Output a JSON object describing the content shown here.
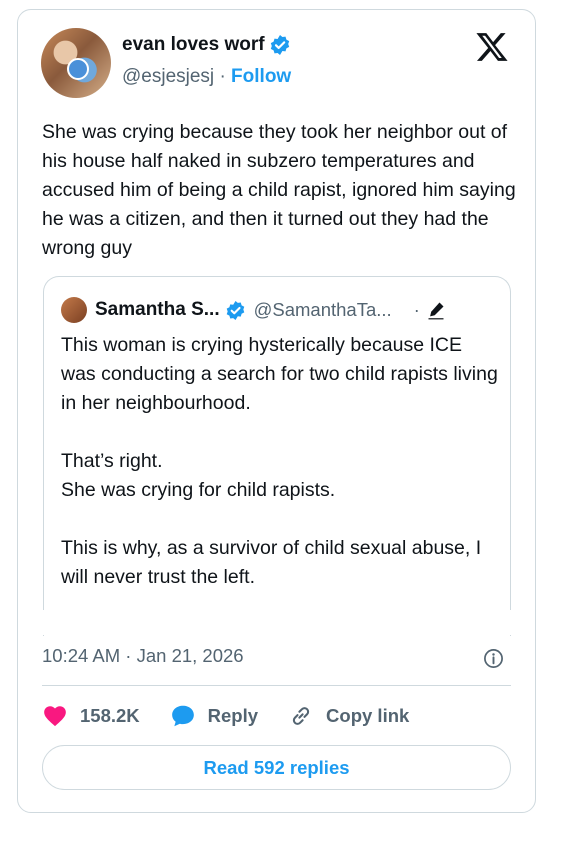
{
  "author": {
    "name": "evan loves worf",
    "handle": "@esjesjesj",
    "separator": "·",
    "follow_label": "Follow"
  },
  "tweet": {
    "text": "She was crying because they took her neighbor out of his house half naked in subzero temperatures and accused him of being a child rapist, ignored him saying he was a citizen, and then it turned out they had the wrong guy"
  },
  "quote": {
    "name": "Samantha S...",
    "handle": "@SamanthaTa...",
    "separator": "·",
    "paragraphs": [
      "This woman is crying hysterically because ICE was conducting a search for two child rapists living in her neighbourhood.",
      "That’s right.\nShe was crying for child rapists.",
      "This is why, as a survivor of child sexual abuse, I will never trust the left."
    ]
  },
  "meta": {
    "timestamp": "10:24 AM · Jan 21, 2026"
  },
  "actions": {
    "like_count": "158.2K",
    "reply_label": "Reply",
    "copy_label": "Copy link"
  },
  "footer": {
    "read_replies_label": "Read 592 replies"
  },
  "colors": {
    "accent": "#1d9bf0",
    "like": "#f91880",
    "text": "#0f1419",
    "muted": "#536471",
    "border": "#cfd9de"
  },
  "icons": [
    "verified-badge-icon",
    "x-logo-icon",
    "grok-icon",
    "info-icon",
    "heart-icon",
    "reply-bubble-icon",
    "link-icon"
  ]
}
